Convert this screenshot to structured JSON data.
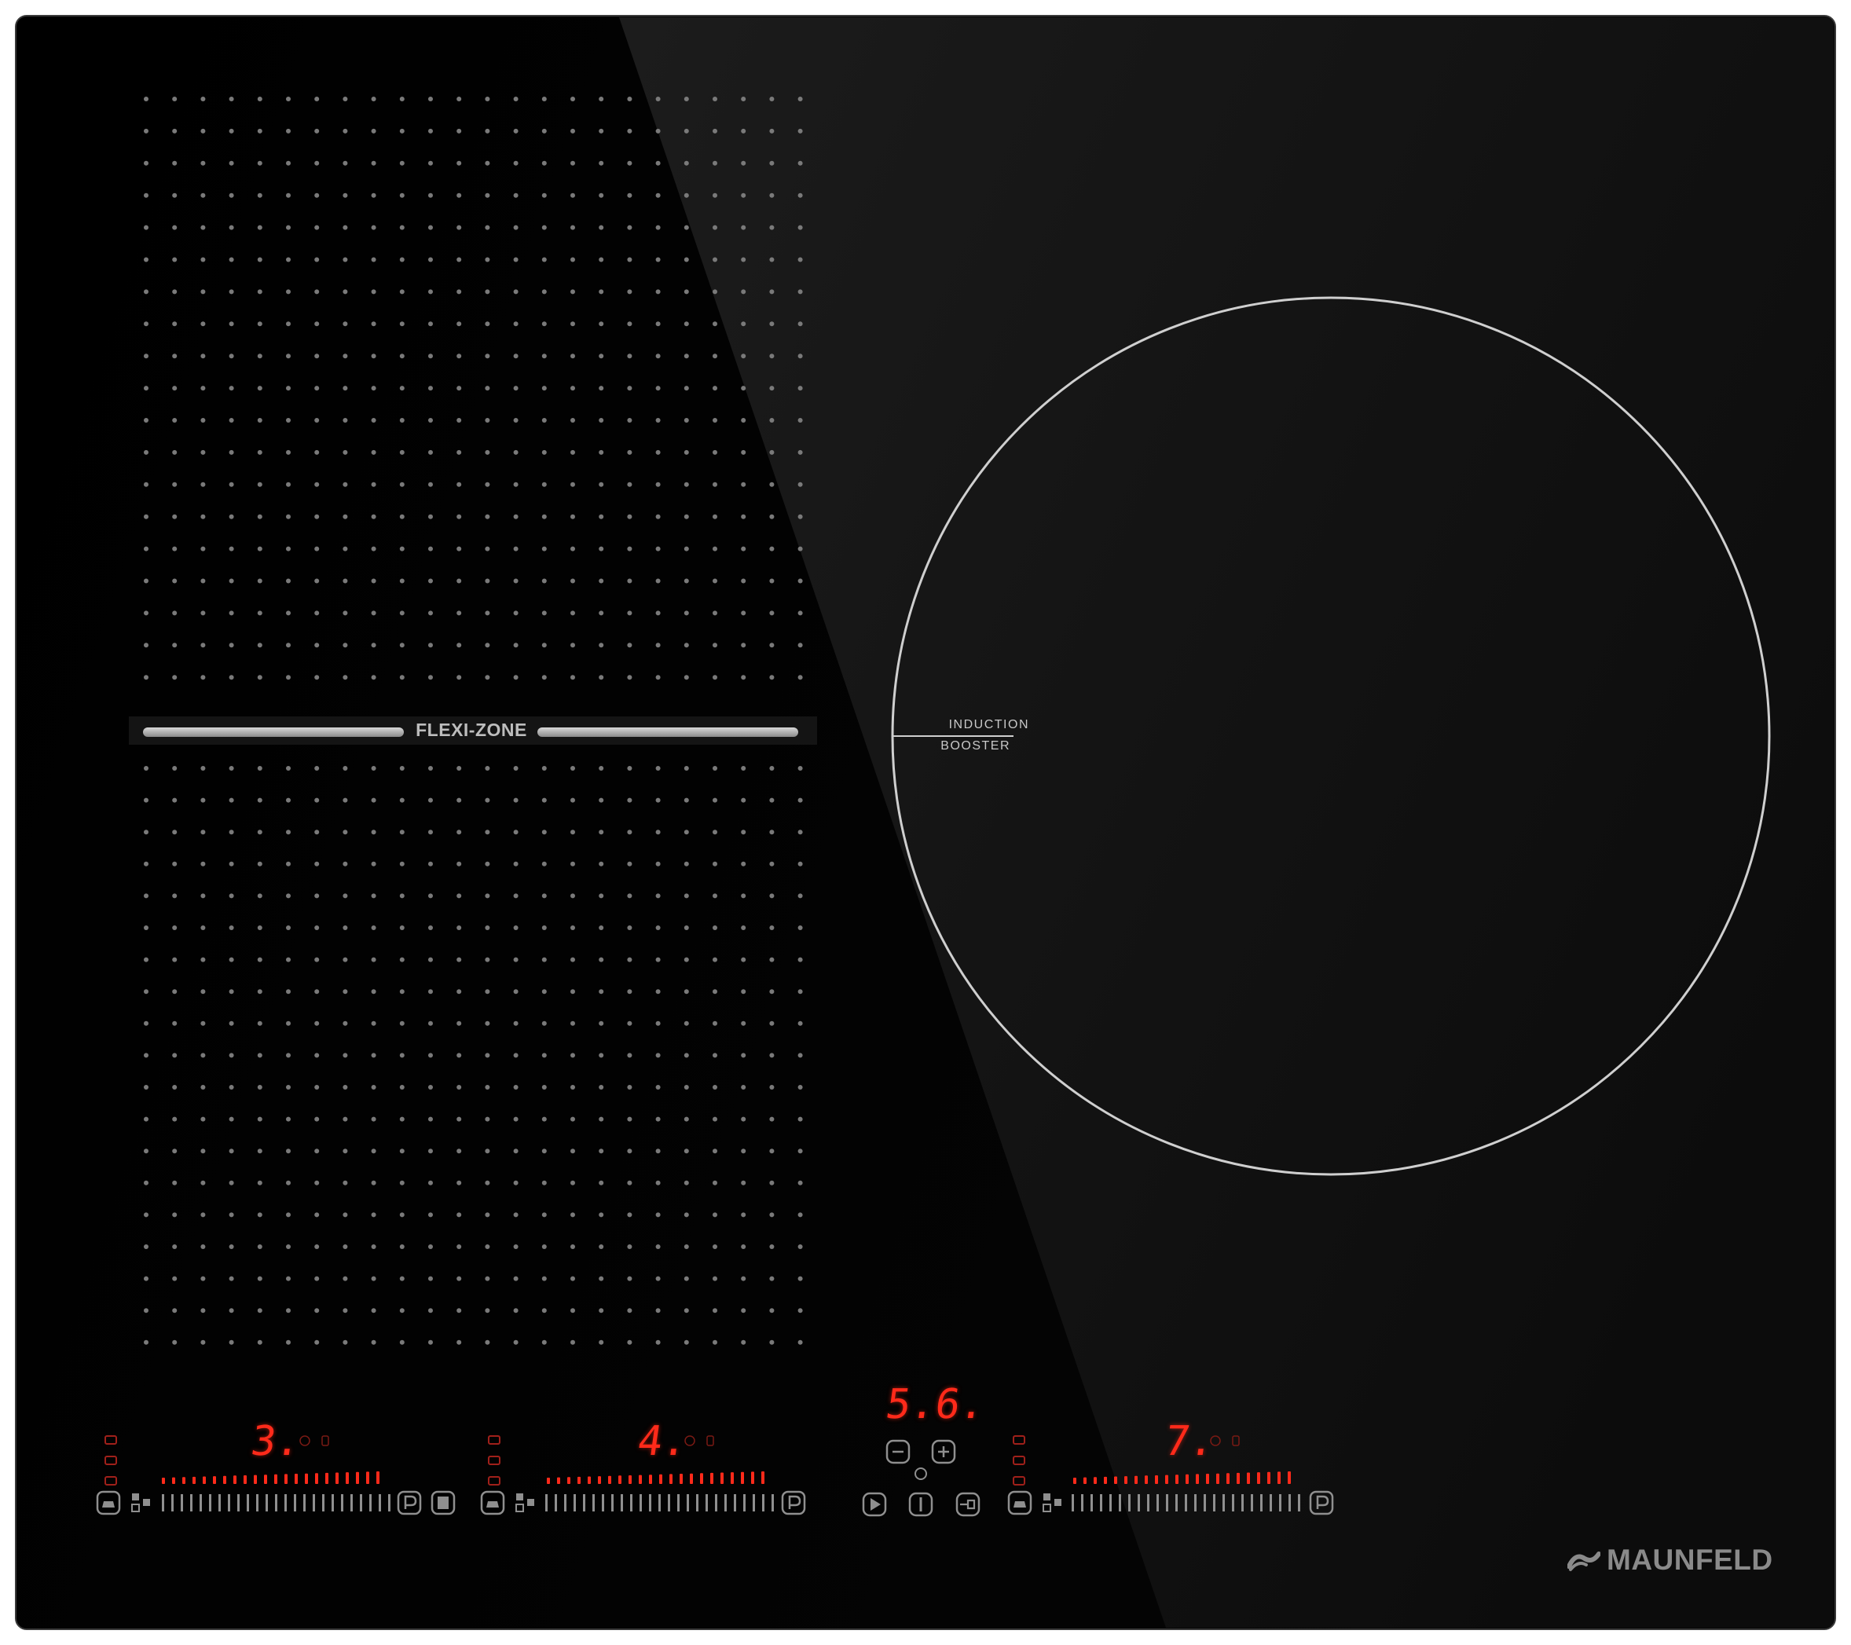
{
  "hob": {
    "flexi_zone_label": "FLEXI-ZONE",
    "booster_zone": {
      "label_top": "INDUCTION",
      "label_bottom": "BOOSTER"
    },
    "brand": "MAUNFELD",
    "brand_icon": "maunfeld-logo-icon",
    "accent_color": "#ff2a1a",
    "controls": {
      "zone_left": {
        "power_level": "3."
      },
      "zone_middle": {
        "power_level": "4."
      },
      "zone_right": {
        "power_level": "7."
      },
      "timer_display": "5.6."
    },
    "icons": [
      "minus-icon",
      "plus-icon",
      "timer-icon",
      "pause-icon",
      "power-icon",
      "lock-icon",
      "pause-menu-icon",
      "power-boost-icon",
      "bridge-icon"
    ]
  }
}
